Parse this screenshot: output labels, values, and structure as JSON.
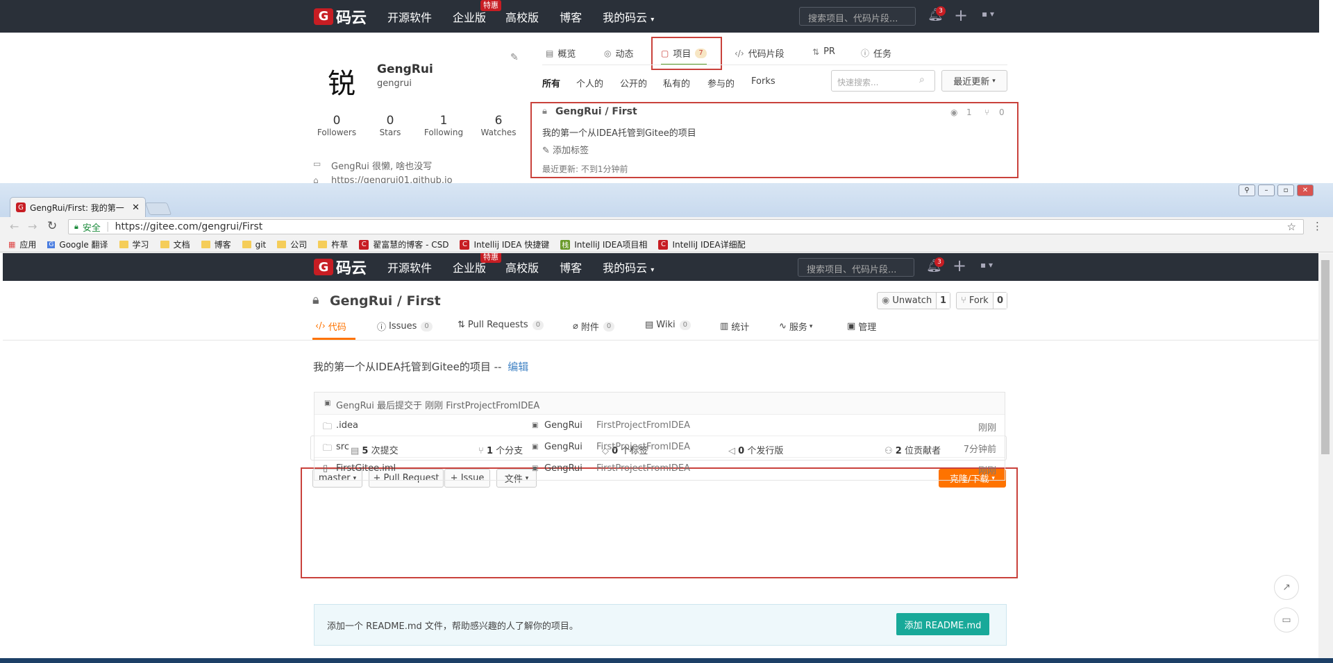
{
  "top_nav": {
    "logo_text": "码云",
    "logo_letter": "G",
    "links": [
      "开源软件",
      "企业版",
      "高校版",
      "博客",
      "我的码云"
    ],
    "enterprise_badge": "特惠",
    "search_placeholder": "搜索项目、代码片段...",
    "notif_count": "3"
  },
  "profile": {
    "avatar_char": "锐",
    "name": "GengRui",
    "username": "gengrui",
    "stats": [
      {
        "num": "0",
        "label": "Followers"
      },
      {
        "num": "0",
        "label": "Stars"
      },
      {
        "num": "1",
        "label": "Following"
      },
      {
        "num": "6",
        "label": "Watches"
      }
    ],
    "bio": "GengRui 很懒, 啥也没写",
    "website": "https://gengrui01.github.io"
  },
  "profile_tabs": {
    "overview": "概览",
    "activity": "动态",
    "projects": "项目",
    "projects_count": "7",
    "snippets": "代码片段",
    "pr": "PR",
    "tasks": "任务"
  },
  "filters": {
    "items": [
      "所有",
      "个人的",
      "公开的",
      "私有的",
      "参与的",
      "Forks"
    ],
    "search_placeholder": "快速搜索...",
    "sort": "最近更新"
  },
  "project_card": {
    "title": "GengRui / First",
    "desc": "我的第一个从IDEA托管到Gitee的项目",
    "add_tag": "添加标签",
    "updated": "最近更新: 不到1分钟前",
    "watch_count": "1",
    "fork_count": "0"
  },
  "browser": {
    "tab_title": "GengRui/First: 我的第一",
    "secure_label": "安全",
    "url": "https://gitee.com/gengrui/First",
    "bookmarks": [
      {
        "icon": "apps",
        "label": "应用"
      },
      {
        "icon": "google",
        "label": "Google 翻译"
      },
      {
        "icon": "folder",
        "label": "学习"
      },
      {
        "icon": "folder",
        "label": "文档"
      },
      {
        "icon": "folder",
        "label": "博客"
      },
      {
        "icon": "folder",
        "label": "git"
      },
      {
        "icon": "folder",
        "label": "公司"
      },
      {
        "icon": "folder",
        "label": "杵草"
      },
      {
        "icon": "csdn",
        "label": "翟富慧的博客 - CSD"
      },
      {
        "icon": "csdn",
        "label": "Intellij IDEA 快捷键"
      },
      {
        "icon": "green",
        "label": "IntelliJ IDEA项目相"
      },
      {
        "icon": "csdn",
        "label": "IntelliJ IDEA详细配"
      }
    ]
  },
  "repo": {
    "title": "GengRui / First",
    "unwatch_label": "Unwatch",
    "unwatch_count": "1",
    "fork_label": "Fork",
    "fork_count": "0",
    "tabs": [
      {
        "label": "代码",
        "count": ""
      },
      {
        "label": "Issues",
        "count": "0"
      },
      {
        "label": "Pull Requests",
        "count": "0"
      },
      {
        "label": "附件",
        "count": "0"
      },
      {
        "label": "Wiki",
        "count": "0"
      },
      {
        "label": "统计",
        "count": ""
      },
      {
        "label": "服务",
        "count": ""
      },
      {
        "label": "管理",
        "count": ""
      }
    ],
    "description": "我的第一个从IDEA托管到Gitee的项目 --",
    "edit_link": "编辑",
    "stats": [
      {
        "num": "5",
        "label": "次提交"
      },
      {
        "num": "1",
        "label": "个分支"
      },
      {
        "num": "0",
        "label": "个标签"
      },
      {
        "num": "0",
        "label": "个发行版"
      },
      {
        "num": "2",
        "label": "位贡献者"
      }
    ],
    "branch": "master",
    "pull_request_btn": "+ Pull Request",
    "issue_btn": "+ Issue",
    "file_btn": "文件",
    "clone_btn": "克隆/下载",
    "last_commit": "GengRui 最后提交于 刚刚 FirstProjectFromIDEA",
    "files": [
      {
        "name": ".idea",
        "type": "folder",
        "author": "GengRui",
        "message": "FirstProjectFromIDEA",
        "time": "刚刚"
      },
      {
        "name": "src",
        "type": "folder",
        "author": "GengRui",
        "message": "FirstProjectFromIDEA",
        "time": "7分钟前"
      },
      {
        "name": "FirstGitee.iml",
        "type": "file",
        "author": "GengRui",
        "message": "FirstProjectFromIDEA",
        "time": "刚刚"
      }
    ],
    "readme_hint": "添加一个 README.md 文件，帮助感兴趣的人了解你的项目。",
    "readme_btn": "添加 README.md"
  },
  "colors": {
    "nav_bg": "#2a3039",
    "brand_red": "#c71d23",
    "clone_orange": "#fe7300",
    "readme_green": "#18a999",
    "highlight_red": "#c9413b"
  }
}
